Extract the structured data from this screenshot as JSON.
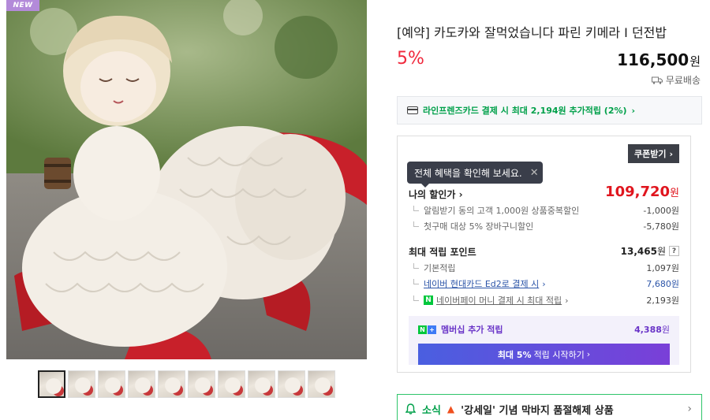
{
  "gallery": {
    "badge": "NEW",
    "thumbnail_count": 10,
    "selected_index": 0
  },
  "product": {
    "title": "[예약] 카도카와 잘먹었습니다 파린 키메라 I 던전밥",
    "discount_rate": "5%",
    "price": "116,500",
    "currency": "원",
    "shipping": "무료배송"
  },
  "card_banner": {
    "text": "라인프렌즈카드 결제 시 최대 2,194원 추가적립 (2%)",
    "chevron": "›"
  },
  "benefits": {
    "coupon_button": "쿠폰받기",
    "tooltip": "전체 혜택을 확인해 보세요.",
    "my_discount_label": "나의 할인가",
    "my_discount_price": "109,720",
    "currency": "원",
    "discounts": [
      {
        "label": "알림받기 동의 고객 1,000원 상품중복할인",
        "value": "-1,000원"
      },
      {
        "label": "첫구매 대상 5% 장바구니할인",
        "value": "-5,780원"
      }
    ],
    "points_title": "최대 적립 포인트",
    "points_total": "13,465",
    "help": "?",
    "points": [
      {
        "label": "기본적립",
        "value": "1,097원"
      },
      {
        "label": "네이버 현대카드 Ed2로 결제 시",
        "value": "7,680원"
      },
      {
        "label": "네이버페이 머니 결제 시 최대 적립",
        "value": "2,193원"
      }
    ],
    "npay_badge": "N",
    "membership": {
      "label": "멤버십 추가 적립",
      "value": "4,388",
      "currency": "원",
      "icon_n": "N",
      "icon_plus": "+",
      "button_bold": "최대 5%",
      "button_rest": "적립 시작하기"
    }
  },
  "news": {
    "label": "소식",
    "text": "'강세일' 기념 막바지 품절해제 상품"
  },
  "colors": {
    "accent_red": "#f0283c",
    "green": "#00a04a",
    "purple": "#6a35c8"
  }
}
